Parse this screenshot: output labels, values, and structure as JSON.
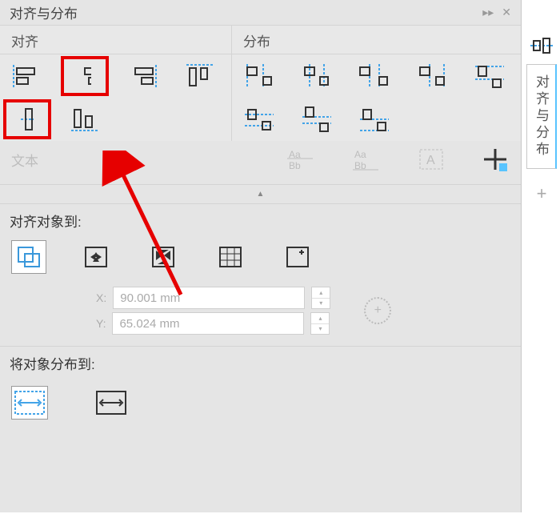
{
  "panel_title": "对齐与分布",
  "sections": {
    "align_label": "对齐",
    "distribute_label": "分布"
  },
  "text_section_label": "文本",
  "align_to_label": "对齐对象到:",
  "distribute_to_label": "将对象分布到:",
  "coords": {
    "x_label": "X:",
    "y_label": "Y:",
    "x_value": "90.001 mm",
    "y_value": "65.024 mm"
  },
  "align_icons": [
    "align-left",
    "align-center-h",
    "align-right",
    "align-top",
    "align-center-v",
    "align-bottom"
  ],
  "distribute_icons": [
    "dist-left",
    "dist-center-h",
    "dist-spacing-h",
    "dist-right",
    "dist-top",
    "dist-center-v",
    "dist-spacing-v",
    "dist-bottom"
  ],
  "text_icons": [
    "text-baseline-1",
    "text-baseline-2",
    "text-box"
  ],
  "plus_icon": "add-guide",
  "target_icons": [
    "active-objects",
    "page-edge",
    "page-center",
    "grid",
    "specified-point"
  ],
  "dist_target_icons": [
    "extent-selection",
    "extent-page"
  ],
  "side_tab_label": "对齐与分布"
}
